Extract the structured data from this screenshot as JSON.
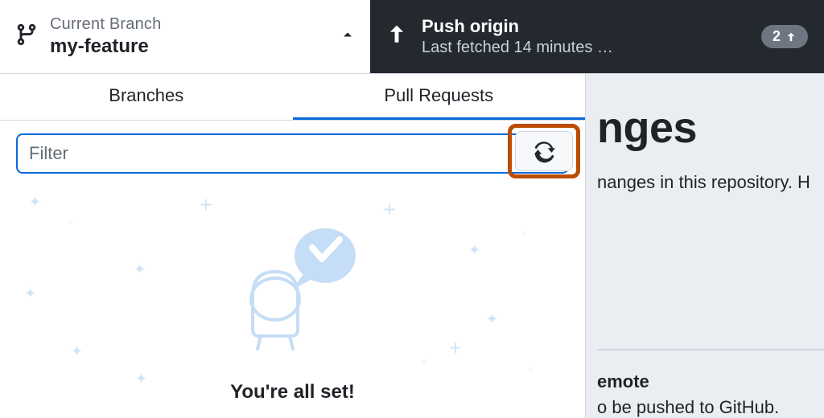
{
  "header": {
    "branch_label": "Current Branch",
    "branch_name": "my-feature",
    "push_title": "Push origin",
    "push_subtitle": "Last fetched 14 minutes …",
    "push_badge_count": "2"
  },
  "tabs": {
    "branches": "Branches",
    "pull_requests": "Pull Requests",
    "active": "pull_requests"
  },
  "filter": {
    "placeholder": "Filter",
    "value": ""
  },
  "empty": {
    "title": "You're all set!"
  },
  "content": {
    "heading_fragment": "nges",
    "subtext_fragment": "nanges in this repository. H",
    "bottom_title_fragment": "emote",
    "bottom_desc_fragment": "o be pushed to GitHub."
  },
  "colors": {
    "accent": "#0969da",
    "highlight_border": "#bc4c00",
    "dark_bg": "#24292f",
    "muted_bg": "#eaeef2"
  }
}
